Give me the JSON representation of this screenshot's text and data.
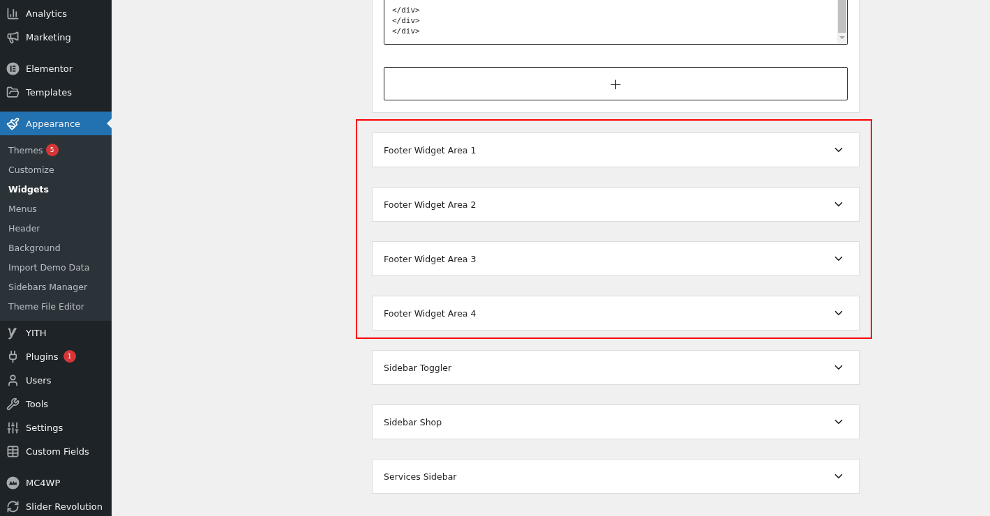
{
  "menu": [
    {
      "kind": "item",
      "label": "Analytics"
    },
    {
      "kind": "item",
      "label": "Marketing"
    },
    {
      "kind": "separator"
    },
    {
      "kind": "item",
      "label": "Elementor"
    },
    {
      "kind": "item",
      "label": "Templates"
    },
    {
      "kind": "separator"
    },
    {
      "kind": "item",
      "label": "Appearance",
      "selected": true,
      "children": [
        {
          "label": "Themes",
          "badge": "5",
          "selected": false
        },
        {
          "label": "Customize",
          "selected": false
        },
        {
          "label": "Widgets",
          "selected": true
        },
        {
          "label": "Menus",
          "selected": false
        },
        {
          "label": "Header",
          "selected": false
        },
        {
          "label": "Background",
          "selected": false
        },
        {
          "label": "Import Demo Data",
          "selected": false
        },
        {
          "label": "Sidebars Manager",
          "selected": false
        },
        {
          "label": "Theme File Editor",
          "selected": false
        }
      ]
    },
    {
      "kind": "item",
      "label": "YITH",
      "selected": false
    },
    {
      "kind": "item",
      "label": "Plugins",
      "badge": "1",
      "selected": false
    },
    {
      "kind": "item",
      "label": "Users",
      "selected": false
    },
    {
      "kind": "item",
      "label": "Tools",
      "selected": false
    },
    {
      "kind": "item",
      "label": "Settings",
      "selected": false
    },
    {
      "kind": "item",
      "label": "Custom Fields",
      "selected": false
    },
    {
      "kind": "separator"
    },
    {
      "kind": "item",
      "label": "MC4WP",
      "selected": false
    },
    {
      "kind": "item",
      "label": "Slider Revolution",
      "selected": false
    }
  ],
  "code_editor": {
    "lines": [
      "</div>",
      "</div>",
      "</div>"
    ]
  },
  "add_block": {
    "label": "+"
  },
  "widget_areas": [
    {
      "title": "Footer Widget Area 1",
      "highlighted": true,
      "expanded": false
    },
    {
      "title": "Footer Widget Area 2",
      "highlighted": true,
      "expanded": false
    },
    {
      "title": "Footer Widget Area 3",
      "highlighted": true,
      "expanded": false
    },
    {
      "title": "Footer Widget Area 4",
      "highlighted": true,
      "expanded": false
    },
    {
      "title": "Sidebar Toggler",
      "highlighted": false,
      "expanded": false
    },
    {
      "title": "Sidebar Shop",
      "highlighted": false,
      "expanded": false
    },
    {
      "title": "Services Sidebar",
      "highlighted": false,
      "expanded": false
    }
  ]
}
